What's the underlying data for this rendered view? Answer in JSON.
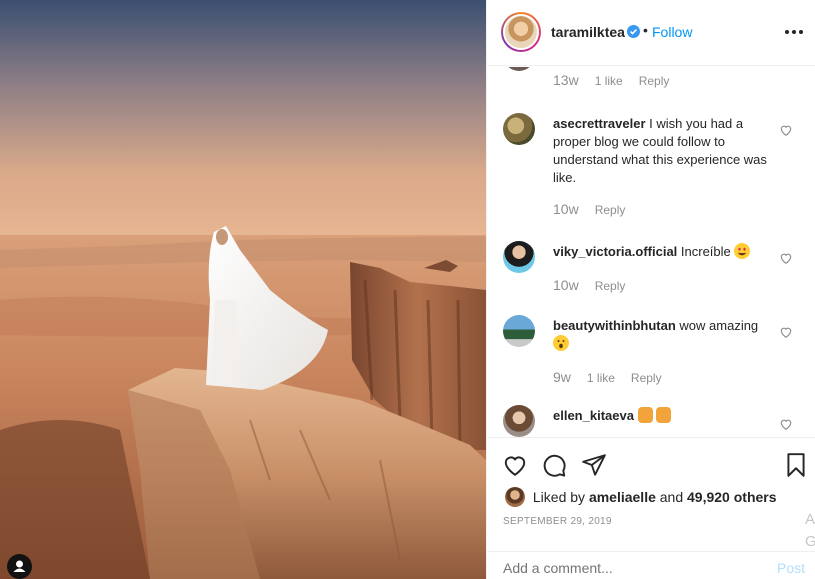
{
  "post": {
    "author": "taramilktea",
    "follow_label": "Follow",
    "separator": "•",
    "icons": {
      "verified": "verified-badge-icon",
      "more": "more-options-icon"
    }
  },
  "comments": [
    {
      "age": "13w",
      "likes": "1 like",
      "reply": "Reply"
    },
    {
      "username": "asecrettraveler",
      "text": "I wish you had a proper blog we could follow to understand what this experience was like.",
      "age": "10w",
      "reply": "Reply"
    },
    {
      "username": "viky_victoria.official",
      "text": "Increíble",
      "emoji": "heart-eyes",
      "age": "10w",
      "reply": "Reply"
    },
    {
      "username": "beautywithinbhutan",
      "text": "wow amazing",
      "emoji": "astonished",
      "age": "9w",
      "likes": "1 like",
      "reply": "Reply"
    },
    {
      "username": "ellen_kitaeva",
      "emoji": "clapping-hands"
    }
  ],
  "actions": {
    "icons": [
      "heart-icon",
      "comment-icon",
      "share-icon",
      "bookmark-icon"
    ]
  },
  "likes": {
    "prefix": "Liked by",
    "user": "ameliaelle",
    "connector": "and",
    "count": "49,920 others"
  },
  "date": "SEPTEMBER 29, 2019",
  "add_comment": {
    "placeholder": "Add a comment...",
    "post_label": "Post"
  },
  "ghost_letters": [
    "A",
    "G"
  ],
  "colors": {
    "link": "#0095f6",
    "muted": "#8e8e8e",
    "post_disabled": "#b2dffc"
  }
}
